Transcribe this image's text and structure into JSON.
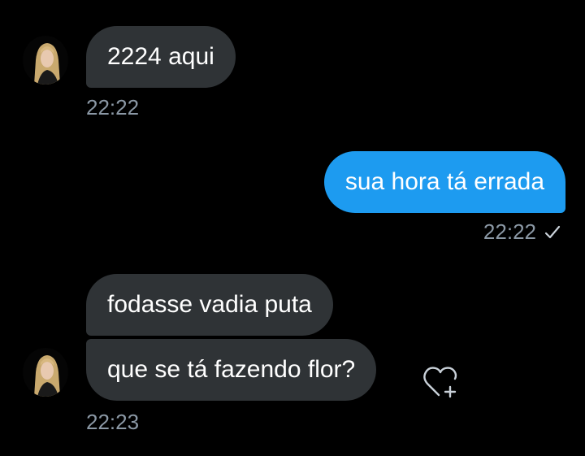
{
  "messages": [
    {
      "direction": "incoming",
      "text": "2224 aqui"
    },
    {
      "direction": "outgoing",
      "text": "sua hora tá errada"
    },
    {
      "direction": "incoming",
      "text": "fodasse vadia puta"
    },
    {
      "direction": "incoming",
      "text": "que se tá fazendo flor?"
    }
  ],
  "timestamps": {
    "first": "22:22",
    "second": "22:22",
    "third": "22:23"
  },
  "icons": {
    "read_receipt": "checkmark-icon",
    "react": "heart-add-icon",
    "avatar": "contact-avatar"
  },
  "colors": {
    "background": "#000000",
    "incoming_bubble": "#2f3336",
    "outgoing_bubble": "#1d9bf0",
    "timestamp": "#8b98a5"
  }
}
